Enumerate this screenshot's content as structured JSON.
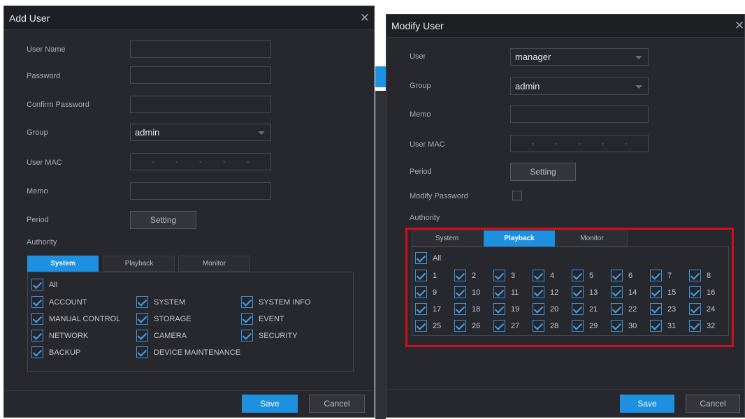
{
  "add_user": {
    "title": "Add User",
    "labels": {
      "user_name": "User Name",
      "password": "Password",
      "confirm_password": "Confirm Password",
      "group": "Group",
      "user_mac": "User MAC",
      "memo": "Memo",
      "period": "Period",
      "authority": "Authority"
    },
    "group_value": "admin",
    "mac_sep": "-",
    "setting_label": "Setting",
    "tabs": [
      "System",
      "Playback",
      "Monitor"
    ],
    "all_label": "All",
    "permissions": [
      [
        "ACCOUNT",
        "SYSTEM",
        "SYSTEM INFO"
      ],
      [
        "MANUAL CONTROL",
        "STORAGE",
        "EVENT"
      ],
      [
        "NETWORK",
        "CAMERA",
        "SECURITY"
      ],
      [
        "BACKUP",
        "DEVICE MAINTENANCE",
        ""
      ]
    ],
    "save_label": "Save",
    "cancel_label": "Cancel"
  },
  "modify_user": {
    "title": "Modify User",
    "labels": {
      "user": "User",
      "group": "Group",
      "memo": "Memo",
      "user_mac": "User MAC",
      "period": "Period",
      "modify_password": "Modify Password",
      "authority": "Authority"
    },
    "user_value": "manager",
    "group_value": "admin",
    "mac_sep": "-",
    "setting_label": "Setting",
    "tabs": [
      "System",
      "Playback",
      "Monitor"
    ],
    "all_label": "All",
    "channels": [
      "1",
      "2",
      "3",
      "4",
      "5",
      "6",
      "7",
      "8",
      "9",
      "10",
      "11",
      "12",
      "13",
      "14",
      "15",
      "16",
      "17",
      "18",
      "19",
      "20",
      "21",
      "22",
      "23",
      "24",
      "25",
      "26",
      "27",
      "28",
      "29",
      "30",
      "31",
      "32"
    ],
    "save_label": "Save",
    "cancel_label": "Cancel"
  },
  "colors": {
    "accent": "#1e90e0",
    "highlight_box": "#d0101a",
    "panel_bg": "#27282e"
  },
  "icons": {
    "close": "close-icon",
    "dropdown": "chevron-down-icon",
    "check": "checkbox-checked-icon"
  }
}
